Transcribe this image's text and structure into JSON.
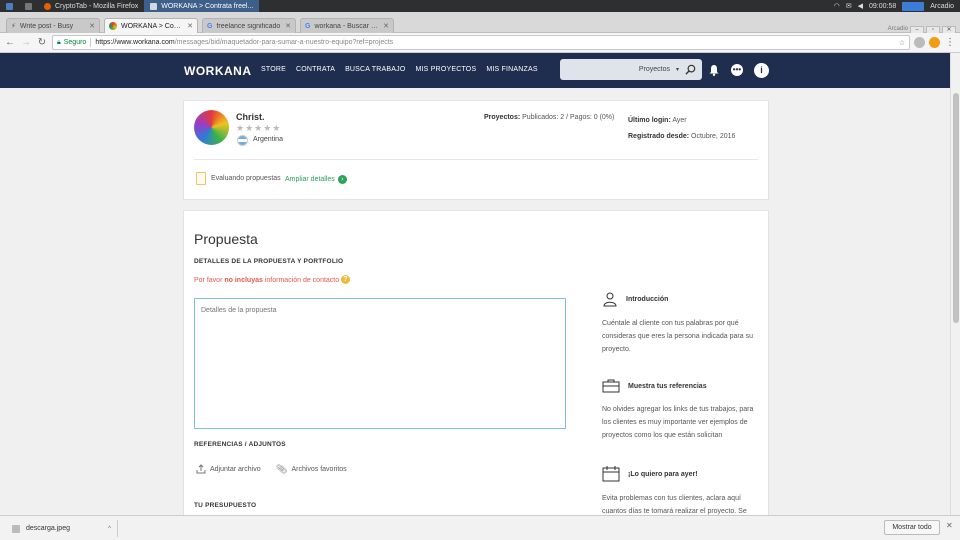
{
  "taskbar": {
    "items": [
      {
        "label": "CryptoTab - Mozilla Firefox",
        "active": false
      },
      {
        "label": "WORKANA > Contrata freel...",
        "active": true
      }
    ],
    "clock": "09:00:58",
    "user": "Arcadio"
  },
  "browser": {
    "profile_name": "Arcadio",
    "tabs": [
      {
        "label": "Write post - Busy",
        "active": false
      },
      {
        "label": "WORKANA > Contrata",
        "active": true
      },
      {
        "label": "freelance significado",
        "active": false
      },
      {
        "label": "workana - Buscar con",
        "active": false
      }
    ],
    "secure_label": "Seguro",
    "url_host": "https://www.workana.com",
    "url_path": "/messages/bid/maquetador-para-sumar-a-nuestro-equipo?ref=projects"
  },
  "site_nav": {
    "logo": "WORKANA",
    "menu": [
      "STORE",
      "CONTRATA",
      "BUSCA TRABAJO",
      "MIS PROYECTOS",
      "MIS FINANZAS"
    ],
    "search_scope": "Proyectos"
  },
  "client": {
    "name": "Christ.",
    "rating": "★★★★★",
    "country": "Argentina",
    "projects_label": "Proyectos:",
    "projects_value": "Publicados: 2 / Pagos: 0 (0%)",
    "last_login_label": "Último login:",
    "last_login_value": "Ayer",
    "registered_label": "Registrado desde:",
    "registered_value": "Octubre, 2016",
    "status_text": "Evaluando propuestas",
    "expand_link": "Ampliar detalles"
  },
  "proposal": {
    "title": "Propuesta",
    "details_heading": "DETALLES DE LA PROPUESTA Y PORTFOLIO",
    "warning_prefix": "Por favor",
    "warning_bold": "no incluyas",
    "warning_suffix": "información de contacto",
    "textarea_placeholder": "Detalles de la propuesta",
    "refs_heading": "REFERENCIAS / ADJUNTOS",
    "attach_file": "Adjuntar archivo",
    "favorite_files": "Archivos favoritos",
    "budget_heading": "TU PRESUPUESTO"
  },
  "tips": [
    {
      "icon": "person-icon",
      "title": "Introducción",
      "body": "Cuéntale al cliente con tus palabras por qué consideras que eres la persona indicada para su proyecto."
    },
    {
      "icon": "briefcase-icon",
      "title": "Muestra tus referencias",
      "body": "No olvides agregar los links de tus trabajos, para los clientes es muy importante ver ejemplos de proyectos como los que están solicitan"
    },
    {
      "icon": "calendar-icon",
      "title": "¡Lo quiero para ayer!",
      "body": "Evita problemas con tus clientes, aclara aquí cuantos días te tomará realizar el proyecto. Se"
    }
  ],
  "downloads": {
    "file": "descarga.jpeg",
    "show_all": "Mostrar todo"
  }
}
